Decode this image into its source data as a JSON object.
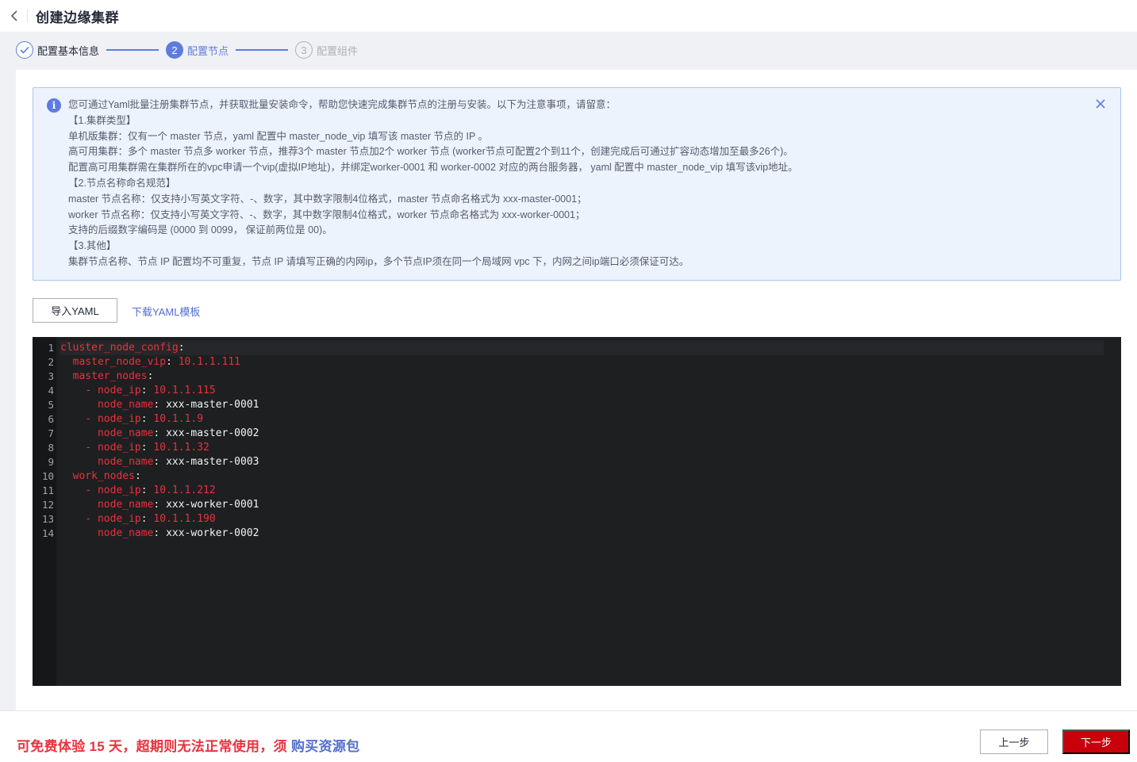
{
  "header": {
    "title": "创建边缘集群"
  },
  "steps": [
    {
      "number": "1",
      "label": "配置基本信息",
      "state": "done"
    },
    {
      "number": "2",
      "label": "配置节点",
      "state": "active"
    },
    {
      "number": "3",
      "label": "配置组件",
      "state": "todo"
    }
  ],
  "notice": {
    "lines": [
      "您可通过Yaml批量注册集群节点，并获取批量安装命令，帮助您快速完成集群节点的注册与安装。以下为注意事项，请留意：",
      "【1.集群类型】",
      "单机版集群：仅有一个 master 节点，yaml 配置中 master_node_vip 填写该 master 节点的 IP 。",
      "高可用集群：多个 master 节点多 worker 节点，推荐3个 master 节点加2个 worker 节点 (worker节点可配置2个到11个，创建完成后可通过扩容动态增加至最多26个)。",
      "配置高可用集群需在集群所在的vpc申请一个vip(虚拟IP地址)，并绑定worker-0001 和 worker-0002 对应的两台服务器， yaml 配置中 master_node_vip 填写该vip地址。",
      "【2.节点名称命名规范】",
      "master 节点名称：仅支持小写英文字符、-、数字，其中数字限制4位格式，master 节点命名格式为 xxx-master-0001；",
      "worker 节点名称：仅支持小写英文字符、-、数字，其中数字限制4位格式，worker 节点命名格式为 xxx-worker-0001；",
      "支持的后缀数字编码是 (0000 到 0099， 保证前两位是 00)。",
      "【3.其他】",
      "集群节点名称、节点 IP 配置均不可重复，节点 IP 请填写正确的内网ip，多个节点IP须在同一个局域网 vpc 下，内网之间ip端口必须保证可达。"
    ]
  },
  "actions": {
    "import_label": "导入YAML",
    "download_label": "下载YAML模板"
  },
  "editor": {
    "line_numbers": [
      "1",
      "2",
      "3",
      "4",
      "5",
      "6",
      "7",
      "8",
      "9",
      "10",
      "11",
      "12",
      "13",
      "14"
    ],
    "lines": [
      {
        "indent": "",
        "dash": "",
        "key": "cluster_node_config",
        "value": "",
        "vtype": ""
      },
      {
        "indent": "  ",
        "dash": "",
        "key": "master_node_vip",
        "value": "10.1.1.111",
        "vtype": "num"
      },
      {
        "indent": "  ",
        "dash": "",
        "key": "master_nodes",
        "value": "",
        "vtype": ""
      },
      {
        "indent": "    ",
        "dash": "- ",
        "key": "node_ip",
        "value": "10.1.1.115",
        "vtype": "num"
      },
      {
        "indent": "      ",
        "dash": "",
        "key": "node_name",
        "value": "xxx-master-0001",
        "vtype": "str"
      },
      {
        "indent": "    ",
        "dash": "- ",
        "key": "node_ip",
        "value": "10.1.1.9",
        "vtype": "num"
      },
      {
        "indent": "      ",
        "dash": "",
        "key": "node_name",
        "value": "xxx-master-0002",
        "vtype": "str"
      },
      {
        "indent": "    ",
        "dash": "- ",
        "key": "node_ip",
        "value": "10.1.1.32",
        "vtype": "num"
      },
      {
        "indent": "      ",
        "dash": "",
        "key": "node_name",
        "value": "xxx-master-0003",
        "vtype": "str"
      },
      {
        "indent": "  ",
        "dash": "",
        "key": "work_nodes",
        "value": "",
        "vtype": ""
      },
      {
        "indent": "    ",
        "dash": "- ",
        "key": "node_ip",
        "value": "10.1.1.212",
        "vtype": "num"
      },
      {
        "indent": "      ",
        "dash": "",
        "key": "node_name",
        "value": "xxx-worker-0001",
        "vtype": "str"
      },
      {
        "indent": "    ",
        "dash": "- ",
        "key": "node_ip",
        "value": "10.1.1.190",
        "vtype": "num"
      },
      {
        "indent": "      ",
        "dash": "",
        "key": "node_name",
        "value": "xxx-worker-0002",
        "vtype": "str"
      }
    ]
  },
  "footer": {
    "trial_text": "可免费体验 15 天，超期则无法正常使用，须 ",
    "trial_link": "购买资源包",
    "prev_label": "上一步",
    "next_label": "下一步"
  },
  "colors": {
    "accent": "#5e7ce0",
    "danger": "#c7000b",
    "link": "#526ecc",
    "notice_bg": "#ecf3fd"
  },
  "icons": {
    "back": "chevron-left-icon",
    "step_done": "check-icon",
    "info": "info-icon",
    "close": "close-icon"
  }
}
